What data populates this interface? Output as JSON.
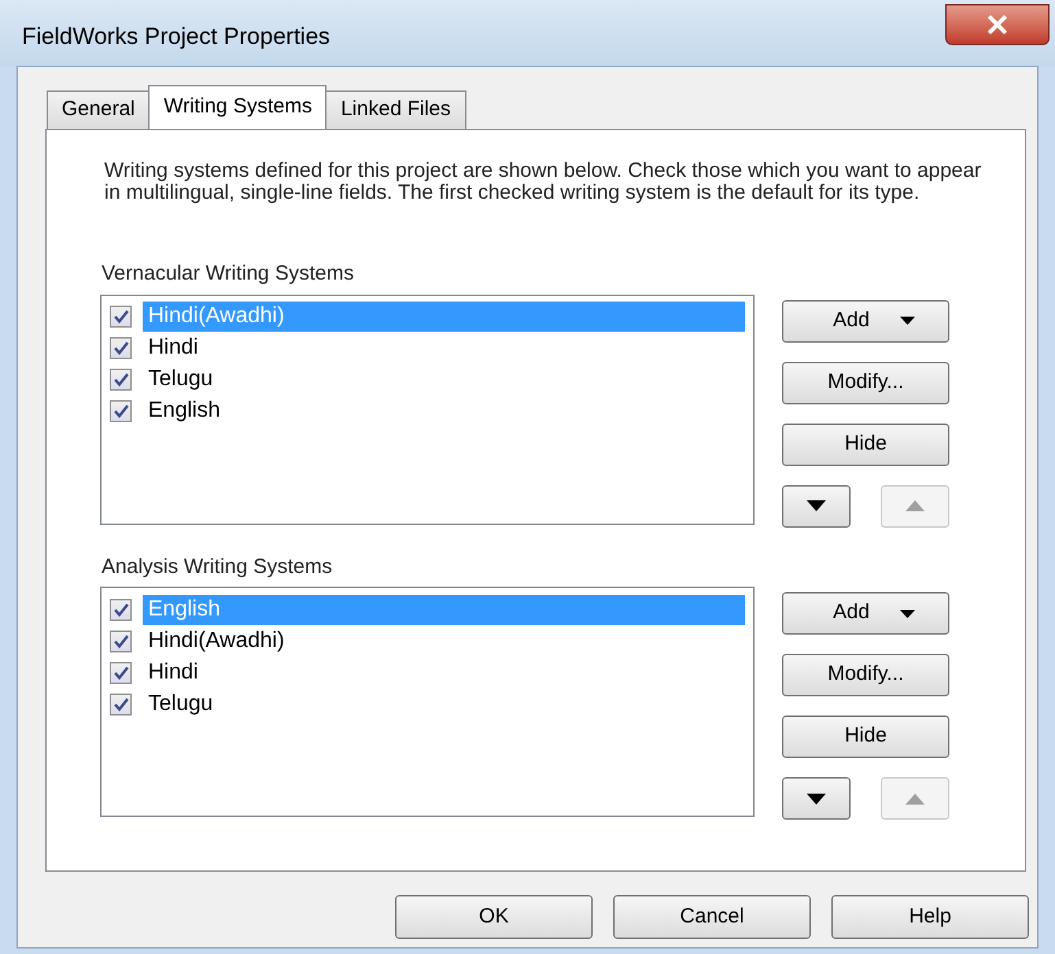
{
  "window": {
    "title": "FieldWorks Project Properties"
  },
  "tabs": [
    {
      "label": "General",
      "selected": false
    },
    {
      "label": "Writing Systems",
      "selected": true
    },
    {
      "label": "Linked Files",
      "selected": false
    }
  ],
  "description": "Writing systems defined for this project are shown below. Check those which you want to appear in multilingual, single-line fields. The first checked writing system is the default for its type.",
  "sections": [
    {
      "label": "Vernacular Writing Systems",
      "items": [
        {
          "label": "Hindi(Awadhi)",
          "checked": true,
          "selected": true
        },
        {
          "label": "Hindi",
          "checked": true,
          "selected": false
        },
        {
          "label": "Telugu",
          "checked": true,
          "selected": false
        },
        {
          "label": "English",
          "checked": true,
          "selected": false
        }
      ],
      "buttons": [
        {
          "kind": "dropdown",
          "label": "Add"
        },
        {
          "kind": "text",
          "label": "Modify..."
        },
        {
          "kind": "text",
          "label": "Hide"
        }
      ],
      "move_down": {
        "disabled": false
      },
      "move_up": {
        "disabled": true
      }
    },
    {
      "label": "Analysis Writing Systems",
      "items": [
        {
          "label": "English",
          "checked": true,
          "selected": true
        },
        {
          "label": "Hindi(Awadhi)",
          "checked": true,
          "selected": false
        },
        {
          "label": "Hindi",
          "checked": true,
          "selected": false
        },
        {
          "label": "Telugu",
          "checked": true,
          "selected": false
        }
      ],
      "buttons": [
        {
          "kind": "dropdown",
          "label": "Add"
        },
        {
          "kind": "text",
          "label": "Modify..."
        },
        {
          "kind": "text",
          "label": "Hide"
        }
      ],
      "move_down": {
        "disabled": false
      },
      "move_up": {
        "disabled": true
      }
    }
  ],
  "footer_buttons": [
    "OK",
    "Cancel",
    "Help"
  ]
}
